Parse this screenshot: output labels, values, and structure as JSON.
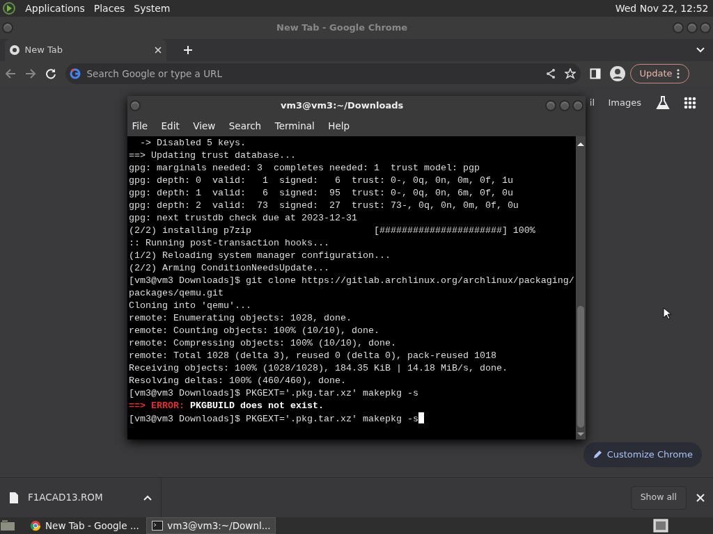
{
  "top_panel": {
    "menus": [
      "Applications",
      "Places",
      "System"
    ],
    "clock": "Wed Nov 22, 12:52"
  },
  "chrome": {
    "title": "New Tab - Google Chrome",
    "tabs": [
      {
        "label": "New Tab",
        "selected": true
      }
    ],
    "omnibox": {
      "placeholder": "Search Google or type a URL"
    },
    "update_button": "Update",
    "page_links": [
      "il",
      "Images"
    ],
    "customize_button": "Customize Chrome",
    "download": {
      "filename": "F1ACAD13.ROM"
    },
    "show_all": "Show all"
  },
  "terminal": {
    "title": "vm3@vm3:~/Downloads",
    "menus": [
      "File",
      "Edit",
      "View",
      "Search",
      "Terminal",
      "Help"
    ],
    "cursor": true,
    "lines": [
      {
        "kind": "plain",
        "text": "  -> Disabled 5 keys."
      },
      {
        "kind": "plain",
        "text": "==> Updating trust database..."
      },
      {
        "kind": "plain",
        "text": "gpg: marginals needed: 3  completes needed: 1  trust model: pgp"
      },
      {
        "kind": "plain",
        "text": "gpg: depth: 0  valid:   1  signed:   6  trust: 0-, 0q, 0n, 0m, 0f, 1u"
      },
      {
        "kind": "plain",
        "text": "gpg: depth: 1  valid:   6  signed:  95  trust: 0-, 0q, 0n, 6m, 0f, 0u"
      },
      {
        "kind": "plain",
        "text": "gpg: depth: 2  valid:  73  signed:  27  trust: 73-, 0q, 0n, 0m, 0f, 0u"
      },
      {
        "kind": "plain",
        "text": "gpg: next trustdb check due at 2023-12-31"
      },
      {
        "kind": "plain",
        "text": "(2/2) installing p7zip                      [######################] 100%"
      },
      {
        "kind": "plain",
        "text": ":: Running post-transaction hooks..."
      },
      {
        "kind": "plain",
        "text": "(1/2) Reloading system manager configuration..."
      },
      {
        "kind": "plain",
        "text": "(2/2) Arming ConditionNeedsUpdate..."
      },
      {
        "kind": "plain",
        "text": "[vm3@vm3 Downloads]$ git clone https://gitlab.archlinux.org/archlinux/packaging/"
      },
      {
        "kind": "plain",
        "text": "packages/qemu.git"
      },
      {
        "kind": "plain",
        "text": "Cloning into 'qemu'..."
      },
      {
        "kind": "plain",
        "text": "remote: Enumerating objects: 1028, done."
      },
      {
        "kind": "plain",
        "text": "remote: Counting objects: 100% (10/10), done."
      },
      {
        "kind": "plain",
        "text": "remote: Compressing objects: 100% (10/10), done."
      },
      {
        "kind": "plain",
        "text": "remote: Total 1028 (delta 3), reused 0 (delta 0), pack-reused 1018"
      },
      {
        "kind": "plain",
        "text": "Receiving objects: 100% (1028/1028), 184.35 KiB | 14.18 MiB/s, done."
      },
      {
        "kind": "plain",
        "text": "Resolving deltas: 100% (460/460), done."
      },
      {
        "kind": "plain",
        "text": "[vm3@vm3 Downloads]$ PKGEXT='.pkg.tar.xz' makepkg -s"
      },
      {
        "kind": "error",
        "arrow": "==>",
        "label": "ERROR:",
        "message": "PKGBUILD does not exist."
      },
      {
        "kind": "plain",
        "text": "[vm3@vm3 Downloads]$ PKGEXT='.pkg.tar.xz' makepkg -s"
      }
    ]
  },
  "taskbar": {
    "tasks": [
      {
        "label": "New Tab - Google ...",
        "selected": false
      },
      {
        "label": "vm3@vm3:~/Downl...",
        "selected": true
      }
    ]
  }
}
